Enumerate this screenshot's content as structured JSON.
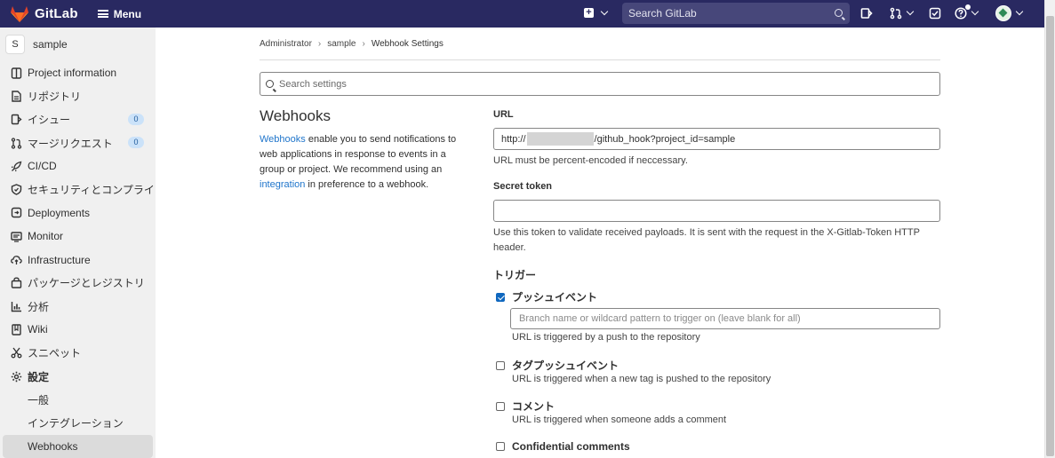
{
  "topbar": {
    "app_name": "GitLab",
    "menu_label": "Menu",
    "search_placeholder": "Search GitLab",
    "brand_color": "#292961"
  },
  "sidebar": {
    "project_initial": "S",
    "project_name": "sample",
    "items": [
      {
        "label": "Project information",
        "icon": "info-icon"
      },
      {
        "label": "リポジトリ",
        "icon": "document-icon"
      },
      {
        "label": "イシュー",
        "icon": "issues-icon",
        "count": "0"
      },
      {
        "label": "マージリクエスト",
        "icon": "merge-request-icon",
        "count": "0"
      },
      {
        "label": "CI/CD",
        "icon": "rocket-icon"
      },
      {
        "label": "セキュリティとコンプライアン",
        "icon": "shield-icon"
      },
      {
        "label": "Deployments",
        "icon": "deployments-icon"
      },
      {
        "label": "Monitor",
        "icon": "monitor-icon"
      },
      {
        "label": "Infrastructure",
        "icon": "cloud-icon"
      },
      {
        "label": "パッケージとレジストリ",
        "icon": "package-icon"
      },
      {
        "label": "分析",
        "icon": "chart-icon"
      },
      {
        "label": "Wiki",
        "icon": "book-icon"
      },
      {
        "label": "スニペット",
        "icon": "scissors-icon"
      },
      {
        "label": "設定",
        "icon": "gear-icon"
      }
    ],
    "sub_items": [
      "一般",
      "インテグレーション",
      "Webhooks"
    ]
  },
  "breadcrumb": [
    "Administrator",
    "sample",
    "Webhook Settings"
  ],
  "settings_search_placeholder": "Search settings",
  "section": {
    "title": "Webhooks",
    "desc_link1": "Webhooks",
    "desc_part1": " enable you to send notifications to web applications in response to events in a group or project. We recommend using an ",
    "desc_link2": "integration",
    "desc_part2": " in preference to a webhook."
  },
  "form": {
    "url_label": "URL",
    "url_prefix": "http://",
    "url_suffix": "/github_hook?project_id=sample",
    "url_help": "URL must be percent-encoded if neccessary.",
    "token_label": "Secret token",
    "token_value": "",
    "token_help": "Use this token to validate received payloads. It is sent with the request in the X-Gitlab-Token HTTP header.",
    "trigger_label": "トリガー",
    "triggers": [
      {
        "label": "プッシュイベント",
        "checked": true,
        "help": "URL is triggered by a push to the repository"
      },
      {
        "label": "タグプッシュイベント",
        "checked": false,
        "help": "URL is triggered when a new tag is pushed to the repository"
      },
      {
        "label": "コメント",
        "checked": false,
        "help": "URL is triggered when someone adds a comment"
      },
      {
        "label": "Confidential comments",
        "checked": false
      }
    ],
    "branch_placeholder": "Branch name or wildcard pattern to trigger on (leave blank for all)"
  }
}
